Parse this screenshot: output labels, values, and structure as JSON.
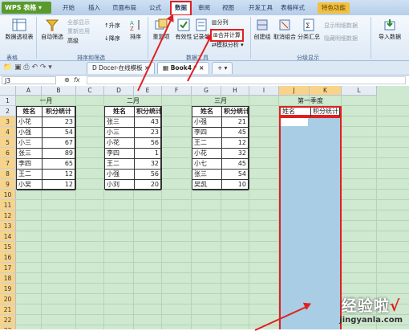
{
  "app": {
    "name": "WPS 表格"
  },
  "ribbon_tabs": [
    {
      "label": "开始"
    },
    {
      "label": "插入"
    },
    {
      "label": "页面布局"
    },
    {
      "label": "公式"
    },
    {
      "label": "数据",
      "active": true
    },
    {
      "label": "审阅"
    },
    {
      "label": "视图"
    },
    {
      "label": "开发工具"
    },
    {
      "label": "表格样式"
    },
    {
      "label": "特色功能"
    }
  ],
  "ribbon": {
    "pivot": "数据透视表",
    "autofilter": "自动筛选",
    "show_all": "全部显示",
    "reapply": "重新应用",
    "advanced": "高级",
    "sort_asc": "升序",
    "sort_desc": "降序",
    "sort": "排序",
    "duplicates": "重复项",
    "validity": "有效性",
    "record_sheet": "记录单",
    "split_col": "分列",
    "consolidate": "合并计算",
    "what_if": "模拟分析",
    "create_group": "创建组",
    "ungroup": "取消组合",
    "subtotal": "分类汇总",
    "show_detail": "显示明细数据",
    "hide_detail": "隐藏明细数据",
    "import": "导入数据",
    "groups": {
      "table": "表格",
      "sortfilter": "排序和筛选",
      "datatools": "数据工具",
      "outline": "分级显示"
    }
  },
  "doc_tabs": [
    {
      "label": "Docer-在线模板"
    },
    {
      "label": "Book4 *",
      "active": true
    }
  ],
  "formula_bar": {
    "name_box": "J3",
    "fx": "fx"
  },
  "columns": [
    "A",
    "B",
    "C",
    "D",
    "E",
    "F",
    "G",
    "H",
    "I",
    "J",
    "K",
    "L"
  ],
  "rows": [
    "1",
    "2",
    "3",
    "4",
    "5",
    "6",
    "7",
    "8",
    "9",
    "10",
    "11",
    "12",
    "13",
    "14",
    "15",
    "16",
    "17",
    "18",
    "19",
    "20",
    "21",
    "22",
    "23"
  ],
  "tables": [
    {
      "title": "一月",
      "headers": [
        "姓名",
        "积分统计"
      ],
      "rows": [
        [
          "小花",
          "23"
        ],
        [
          "小强",
          "54"
        ],
        [
          "小三",
          "67"
        ],
        [
          "张三",
          "89"
        ],
        [
          "李四",
          "65"
        ],
        [
          "王二",
          "12"
        ],
        [
          "小吴",
          "12"
        ]
      ]
    },
    {
      "title": "二月",
      "headers": [
        "姓名",
        "积分统计"
      ],
      "rows": [
        [
          "张三",
          "43"
        ],
        [
          "小三",
          "23"
        ],
        [
          "小花",
          "56"
        ],
        [
          "李四",
          "1"
        ],
        [
          "王二",
          "32"
        ],
        [
          "小强",
          "56"
        ],
        [
          "小刘",
          "20"
        ]
      ]
    },
    {
      "title": "三月",
      "headers": [
        "姓名",
        "积分统计"
      ],
      "rows": [
        [
          "小强",
          "21"
        ],
        [
          "李四",
          "45"
        ],
        [
          "王二",
          "12"
        ],
        [
          "小花",
          "32"
        ],
        [
          "小七",
          "45"
        ],
        [
          "张三",
          "54"
        ],
        [
          "吴凯",
          "10"
        ]
      ]
    }
  ],
  "summary": {
    "title": "第一季度",
    "headers": [
      "姓名",
      "积分统计"
    ]
  },
  "watermark": {
    "main": "经验啦",
    "check": "√",
    "domain": "jingyanla.com"
  },
  "colors": {
    "accent_red": "#e02020",
    "selection_blue": "#a9cde4",
    "sheet_bg": "#cfe8d0"
  }
}
